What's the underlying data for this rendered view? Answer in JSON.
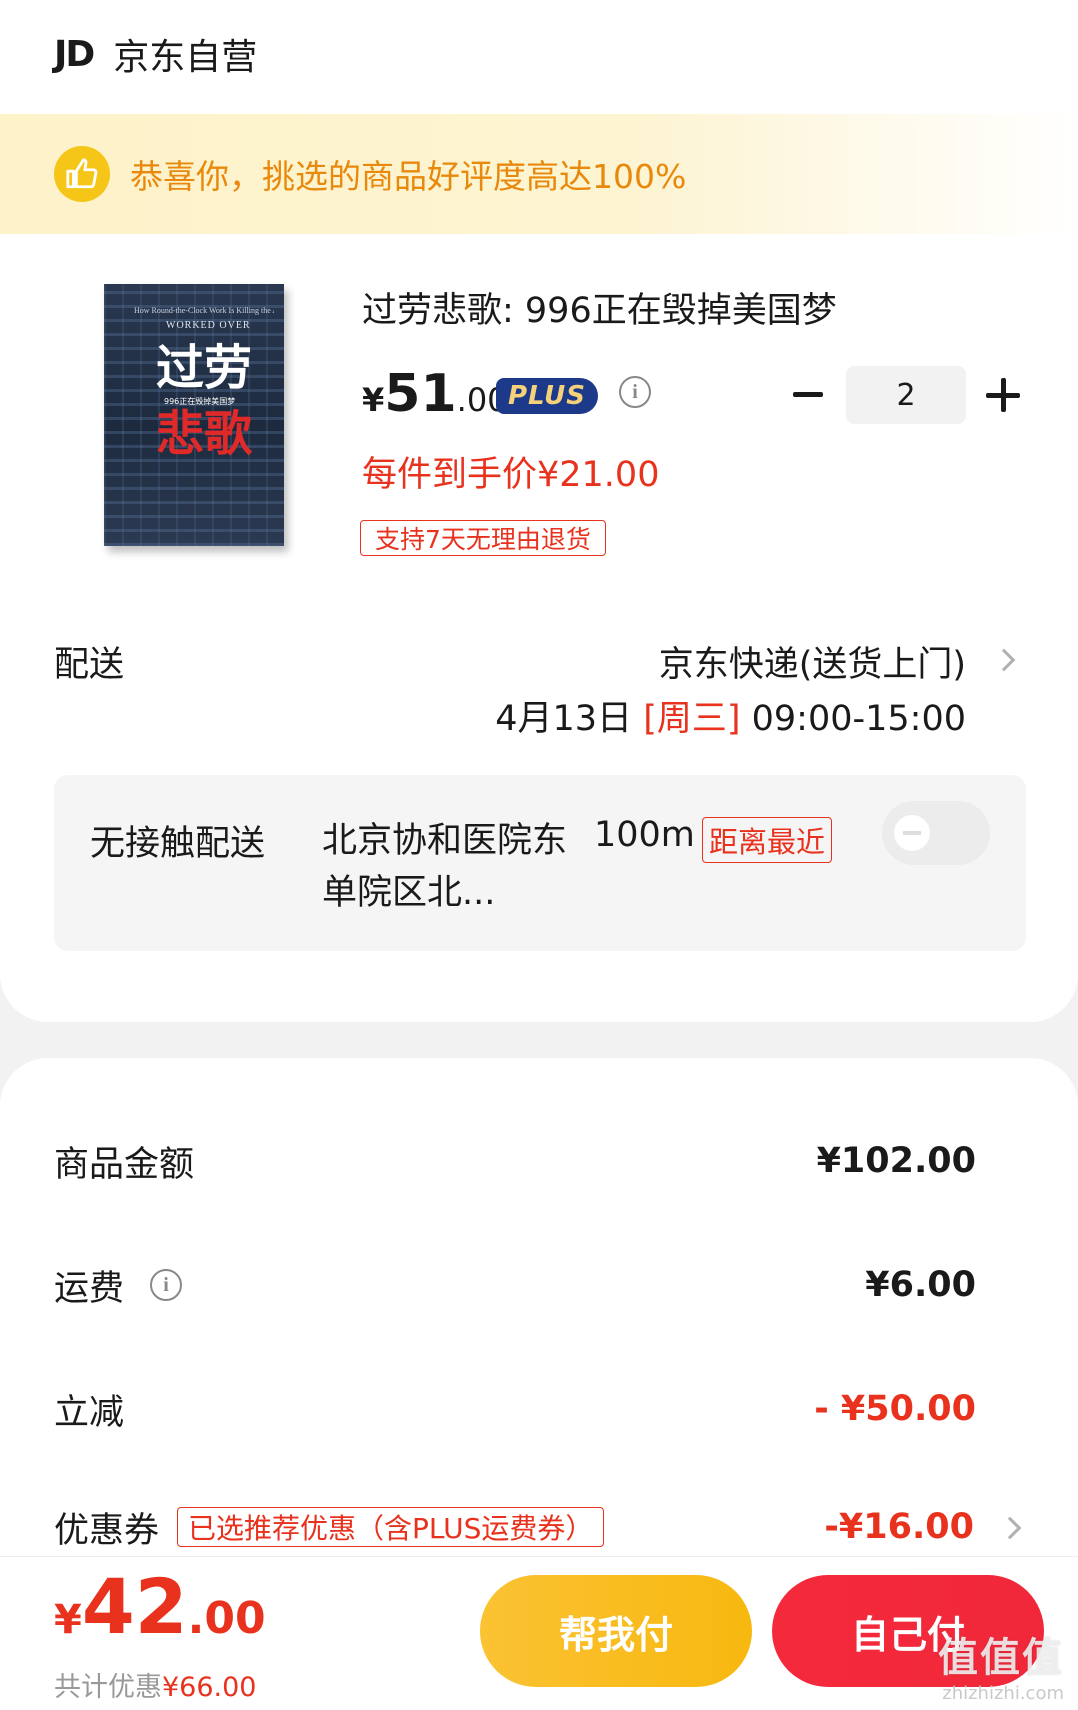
{
  "shop": {
    "logo": "JD",
    "name": "京东自营"
  },
  "banner": {
    "icon": "thumbs-up-icon",
    "text": "恭喜你，挑选的商品好评度高达100%"
  },
  "product": {
    "cover": {
      "en_line": "How Round-the-Clock Work Is Killing the American Dream",
      "en_title": "WORKED OVER",
      "title_top": "过劳",
      "title_bottom": "悲歌",
      "subtitle": "996正在毁掉美国梦"
    },
    "title": "过劳悲歌: 996正在毁掉美国梦",
    "price": {
      "symbol": "¥",
      "integer": "51",
      "decimal": ".00"
    },
    "plus_badge": "PLUS",
    "quantity": "2",
    "hand_price": "每件到手价¥21.00",
    "return_tag": "支持7天无理由退货"
  },
  "delivery": {
    "label": "配送",
    "method": "京东快递(送货上门)",
    "date": "4月13日",
    "weekday": "[周三]",
    "time": "09:00-15:00",
    "contactless": {
      "label": "无接触配送",
      "place": "北京协和医院东单院区北...",
      "distance": "100m",
      "nearest_tag": "距离最近"
    }
  },
  "summary": {
    "goods_label": "商品金额",
    "goods_value": "¥102.00",
    "freight_label": "运费",
    "freight_value": "¥6.00",
    "discount_label": "立减",
    "discount_value": "- ¥50.00",
    "coupon_label": "优惠券",
    "coupon_tag": "已选推荐优惠（含PLUS运费券）",
    "coupon_value": "-¥16.00"
  },
  "footer": {
    "total_symbol": "¥",
    "total_integer": "42",
    "total_decimal": ".00",
    "saved_label": "共计优惠",
    "saved_amount": "¥66.00",
    "help_pay": "帮我付",
    "self_pay": "自己付"
  },
  "watermark": {
    "line1": "值值值",
    "line2": "zhizhizhi.com"
  },
  "colors": {
    "red": "#e8321e",
    "yellow": "#f7b80f",
    "banner": "#fdf2c8",
    "plus": "#1d3a8a"
  }
}
